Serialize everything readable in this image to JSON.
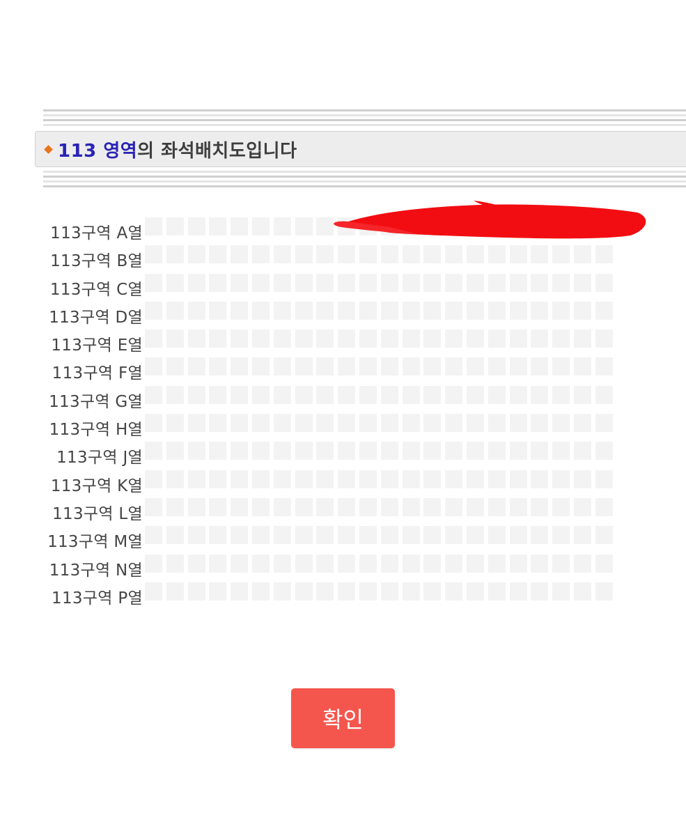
{
  "header": {
    "title_highlight": "113 영역",
    "title_rest": "의 좌석배치도입니다"
  },
  "seat_map": {
    "rows": [
      {
        "label": "113구역 A열"
      },
      {
        "label": "113구역 B열"
      },
      {
        "label": "113구역 C열"
      },
      {
        "label": "113구역 D열"
      },
      {
        "label": "113구역 E열"
      },
      {
        "label": "113구역 F열"
      },
      {
        "label": "113구역 G열"
      },
      {
        "label": "113구역 H열"
      },
      {
        "label": "113구역 J열"
      },
      {
        "label": "113구역 K열"
      },
      {
        "label": "113구역 L열"
      },
      {
        "label": "113구역 M열"
      },
      {
        "label": "113구역 N열"
      },
      {
        "label": "113구역 P열"
      }
    ],
    "seats_per_row": 22,
    "seat_color": "#f3f3f3"
  },
  "colors": {
    "title_highlight": "#2a23b6",
    "title_text": "#3e3e3e",
    "bullet": "#e8741e",
    "confirm_button": "#f4564d",
    "redaction": "#f20d12"
  },
  "confirm_button": {
    "label": "확인"
  }
}
